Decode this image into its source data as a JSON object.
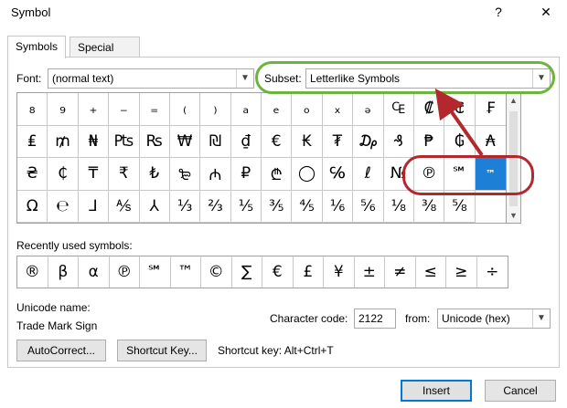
{
  "window": {
    "title": "Symbol",
    "help": "?",
    "close": "✕"
  },
  "tabs": [
    {
      "label": "Symbols"
    },
    {
      "label": "Special Characters"
    }
  ],
  "font": {
    "label": "Font:",
    "value": "(normal text)"
  },
  "subset": {
    "label": "Subset:",
    "value": "Letterlike Symbols"
  },
  "symbols": [
    "₈",
    "₉",
    "₊",
    "₋",
    "₌",
    "₍",
    "₎",
    "ₐ",
    "ₑ",
    "ₒ",
    "ₓ",
    "ₔ",
    "₠",
    "₡",
    "₢",
    "₣",
    "₤",
    "₥",
    "₦",
    "₧",
    "₨",
    "₩",
    "₪",
    "₫",
    "€",
    "₭",
    "₮",
    "₯",
    "₰",
    "₱",
    "₲",
    "₳",
    "₴",
    "₵",
    "₸",
    "₹",
    "₺",
    "₻",
    "₼",
    "₽",
    "₾",
    "◯",
    "℅",
    "ℓ",
    "№",
    "℗",
    "℠",
    "™",
    "Ω",
    "℮",
    "⅃",
    "⅍",
    "⅄",
    "⅓",
    "⅔",
    "⅕",
    "⅗",
    "⅘",
    "⅙",
    "⅚",
    "⅛",
    "⅜",
    "⅝"
  ],
  "selected_symbol": "™",
  "recent": {
    "label": "Recently used symbols:",
    "symbols": [
      "®",
      "β",
      "α",
      "℗",
      "℠",
      "™",
      "©",
      "∑",
      "€",
      "£",
      "¥",
      "±",
      "≠",
      "≤",
      "≥",
      "÷"
    ]
  },
  "unicode_name": {
    "label": "Unicode name:",
    "value": "Trade Mark Sign"
  },
  "character_code": {
    "label": "Character code:",
    "value": "2122"
  },
  "from": {
    "label": "from:",
    "value": "Unicode (hex)"
  },
  "buttons": {
    "autocorrect": "AutoCorrect...",
    "shortcut_key": "Shortcut Key...",
    "insert": "Insert",
    "cancel": "Cancel"
  },
  "shortcut_text": "Shortcut key: Alt+Ctrl+T",
  "annotation_colors": {
    "green": "#6db33f",
    "red": "#b3282d"
  }
}
